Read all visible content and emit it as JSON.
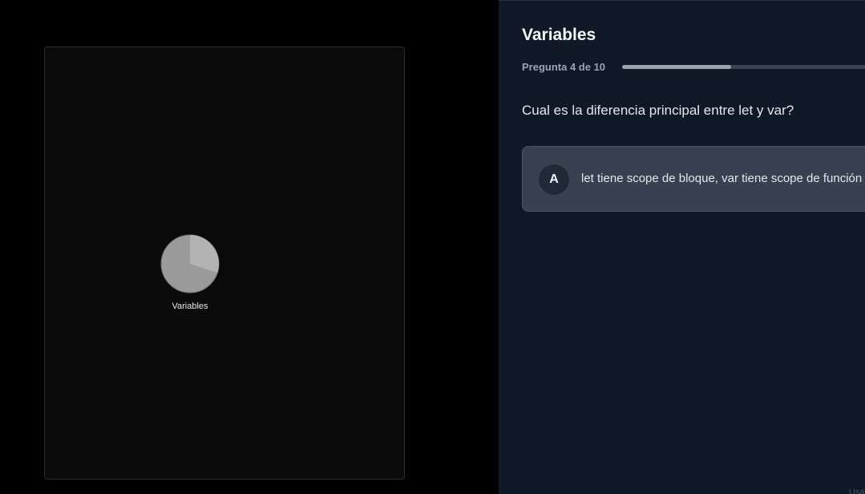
{
  "canvas": {
    "node": {
      "label": "Variables",
      "progress_fraction": 0.4,
      "colors": {
        "fill": "#9a9a9a",
        "slice": "#b3b3b3",
        "stroke": "#6e6e6e"
      }
    }
  },
  "quiz": {
    "title": "Variables",
    "progress_label": "Pregunta 4 de 10",
    "progress_fraction": 0.4,
    "question": "Cual es la diferencia principal entre let y var?",
    "options": [
      {
        "letter": "A",
        "text": "let tiene scope de bloque, var tiene scope de función"
      }
    ],
    "corner_hint": "Usa"
  },
  "colors": {
    "panel_background": "#111827",
    "option_background": "#374151",
    "progress_fill": "#9ca3af",
    "progress_track": "#374151"
  }
}
